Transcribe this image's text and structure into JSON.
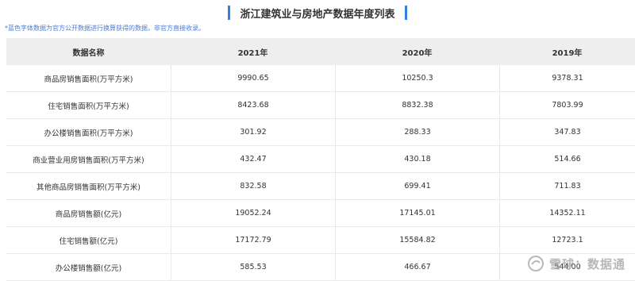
{
  "title": "浙江建筑业与房地产数据年度列表",
  "note": "*蓝色字体数据为官方公开数据进行换算获得的数据，非官方直接收录。",
  "table": {
    "headers": [
      "数据名称",
      "2021年",
      "2020年",
      "2019年"
    ],
    "rows": [
      [
        "商品房销售面积(万平方米)",
        "9990.65",
        "10250.3",
        "9378.31"
      ],
      [
        "住宅销售面积(万平方米)",
        "8423.68",
        "8832.38",
        "7803.99"
      ],
      [
        "办公楼销售面积(万平方米)",
        "301.92",
        "288.33",
        "347.83"
      ],
      [
        "商业营业用房销售面积(万平方米)",
        "432.47",
        "430.18",
        "514.66"
      ],
      [
        "其他商品房销售面积(万平方米)",
        "832.58",
        "699.41",
        "711.83"
      ],
      [
        "商品房销售额(亿元)",
        "19052.24",
        "17145.01",
        "14352.11"
      ],
      [
        "住宅销售额(亿元)",
        "17172.79",
        "15584.82",
        "12723.1"
      ],
      [
        "办公楼销售额(亿元)",
        "585.53",
        "466.67",
        "544.00"
      ]
    ]
  },
  "watermark": {
    "text": "雪球：数据通",
    "icon": "snowball-logo-icon"
  }
}
